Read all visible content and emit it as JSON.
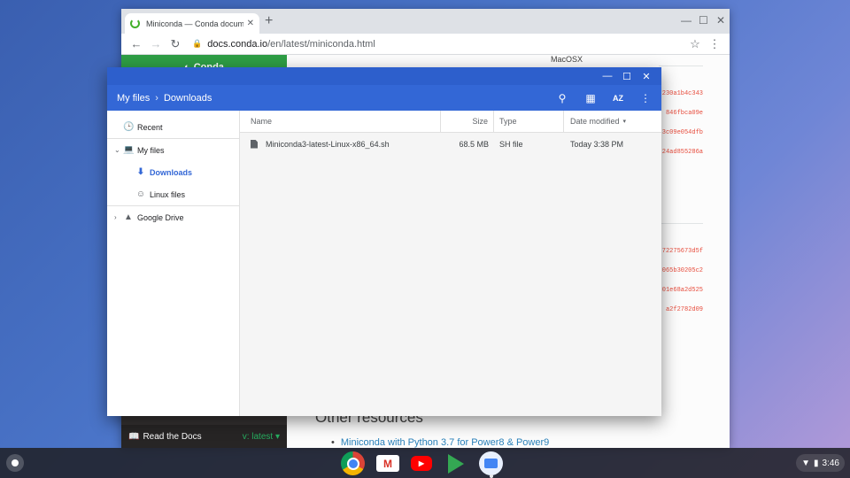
{
  "browser": {
    "tab_title": "Miniconda — Conda documentati",
    "url_host": "docs.conda.io",
    "url_path": "/en/latest/miniconda.html",
    "icons": {
      "back": "arrow-left-icon",
      "forward": "arrow-right-icon",
      "reload": "reload-icon",
      "star": "star-icon",
      "menu": "kebab-menu-icon"
    }
  },
  "docs": {
    "sidebar_brand": "Conda",
    "column_header": "MacOSX",
    "hashes_top": [
      "230a1b4c343",
      "846fbca09e",
      "3c09e054dfb",
      "24ad855286a"
    ],
    "hashes_bottom": [
      "72275673d5f",
      "065b30205c2",
      "01e68a2d525",
      "a2f2782d09"
    ],
    "other_resources": "Other resources",
    "link_power": "Miniconda with Python 3.7 for Power8 & Power9",
    "read_the_docs": "Read the Docs",
    "version": "v: latest"
  },
  "files_app": {
    "breadcrumb": [
      "My files",
      "Downloads"
    ],
    "nav": {
      "recent": "Recent",
      "my_files": "My files",
      "downloads": "Downloads",
      "linux_files": "Linux files",
      "google_drive": "Google Drive"
    },
    "columns": {
      "name": "Name",
      "size": "Size",
      "type": "Type",
      "date": "Date modified"
    },
    "files": [
      {
        "name": "Miniconda3-latest-Linux-x86_64.sh",
        "size": "68.5 MB",
        "type": "SH file",
        "date": "Today 3:38 PM"
      }
    ],
    "sort_label": "AZ"
  },
  "shelf": {
    "apps": [
      "Chrome",
      "Gmail",
      "YouTube",
      "Play Store",
      "Files"
    ],
    "time": "3:46"
  },
  "colors": {
    "accent": "#3367d6",
    "rtd_green": "#2e9e45"
  }
}
